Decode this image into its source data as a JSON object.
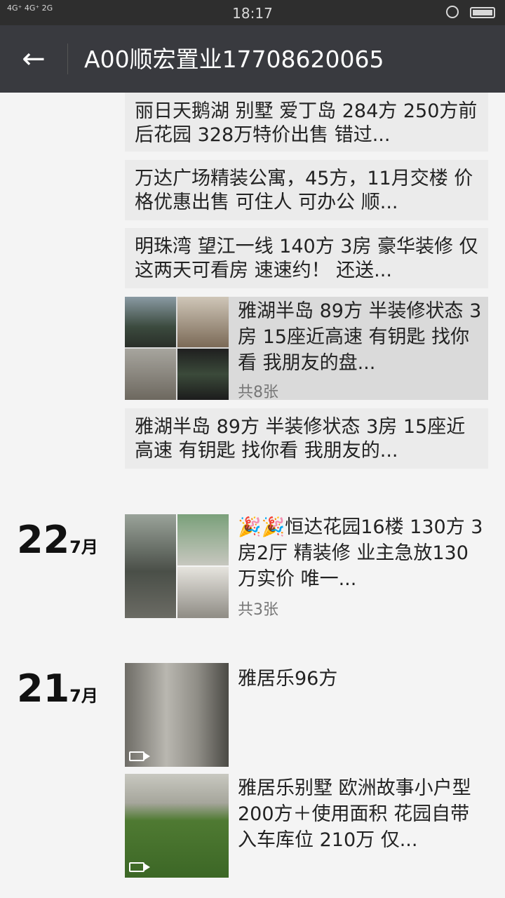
{
  "status_bar": {
    "signal": "4G⁺ 4G⁺ 2G",
    "time": "18:17"
  },
  "header": {
    "title": "A00顺宏置业17708620065"
  },
  "cards": [
    {
      "text": "丽日天鹅湖 别墅 爱丁岛 284方 250方前后花园 328万特价出售 错过..."
    },
    {
      "text": "万达广场精装公寓，45方，11月交楼 价格优惠出售 可住人 可办公 顺..."
    },
    {
      "text": "明珠湾 望江一线 140方  3房 豪华装修 仅这两天可看房 速速约！  还送..."
    }
  ],
  "photo_post_1": {
    "text": "雅湖半岛 89方 半装修状态 3房 15座近高速  有钥匙 找你看 我朋友的盘...",
    "count": "共8张"
  },
  "card_4": {
    "text": "雅湖半岛 89方 半装修状态  3房 15座近高速 有钥匙 找你看 我朋友的..."
  },
  "date_22": {
    "day": "22",
    "month": "7月"
  },
  "post_22": {
    "text": "🎉🎉恒达花园16楼  130方   3房2厅   精装修   业主急放130万实价   唯一...",
    "count": "共3张"
  },
  "date_21": {
    "day": "21",
    "month": "7月"
  },
  "post_21a": {
    "text": "雅居乐96方"
  },
  "post_21b": {
    "text": "雅居乐别墅 欧洲故事小户型 200方＋使用面积 花园自带入车库位 210万 仅..."
  }
}
